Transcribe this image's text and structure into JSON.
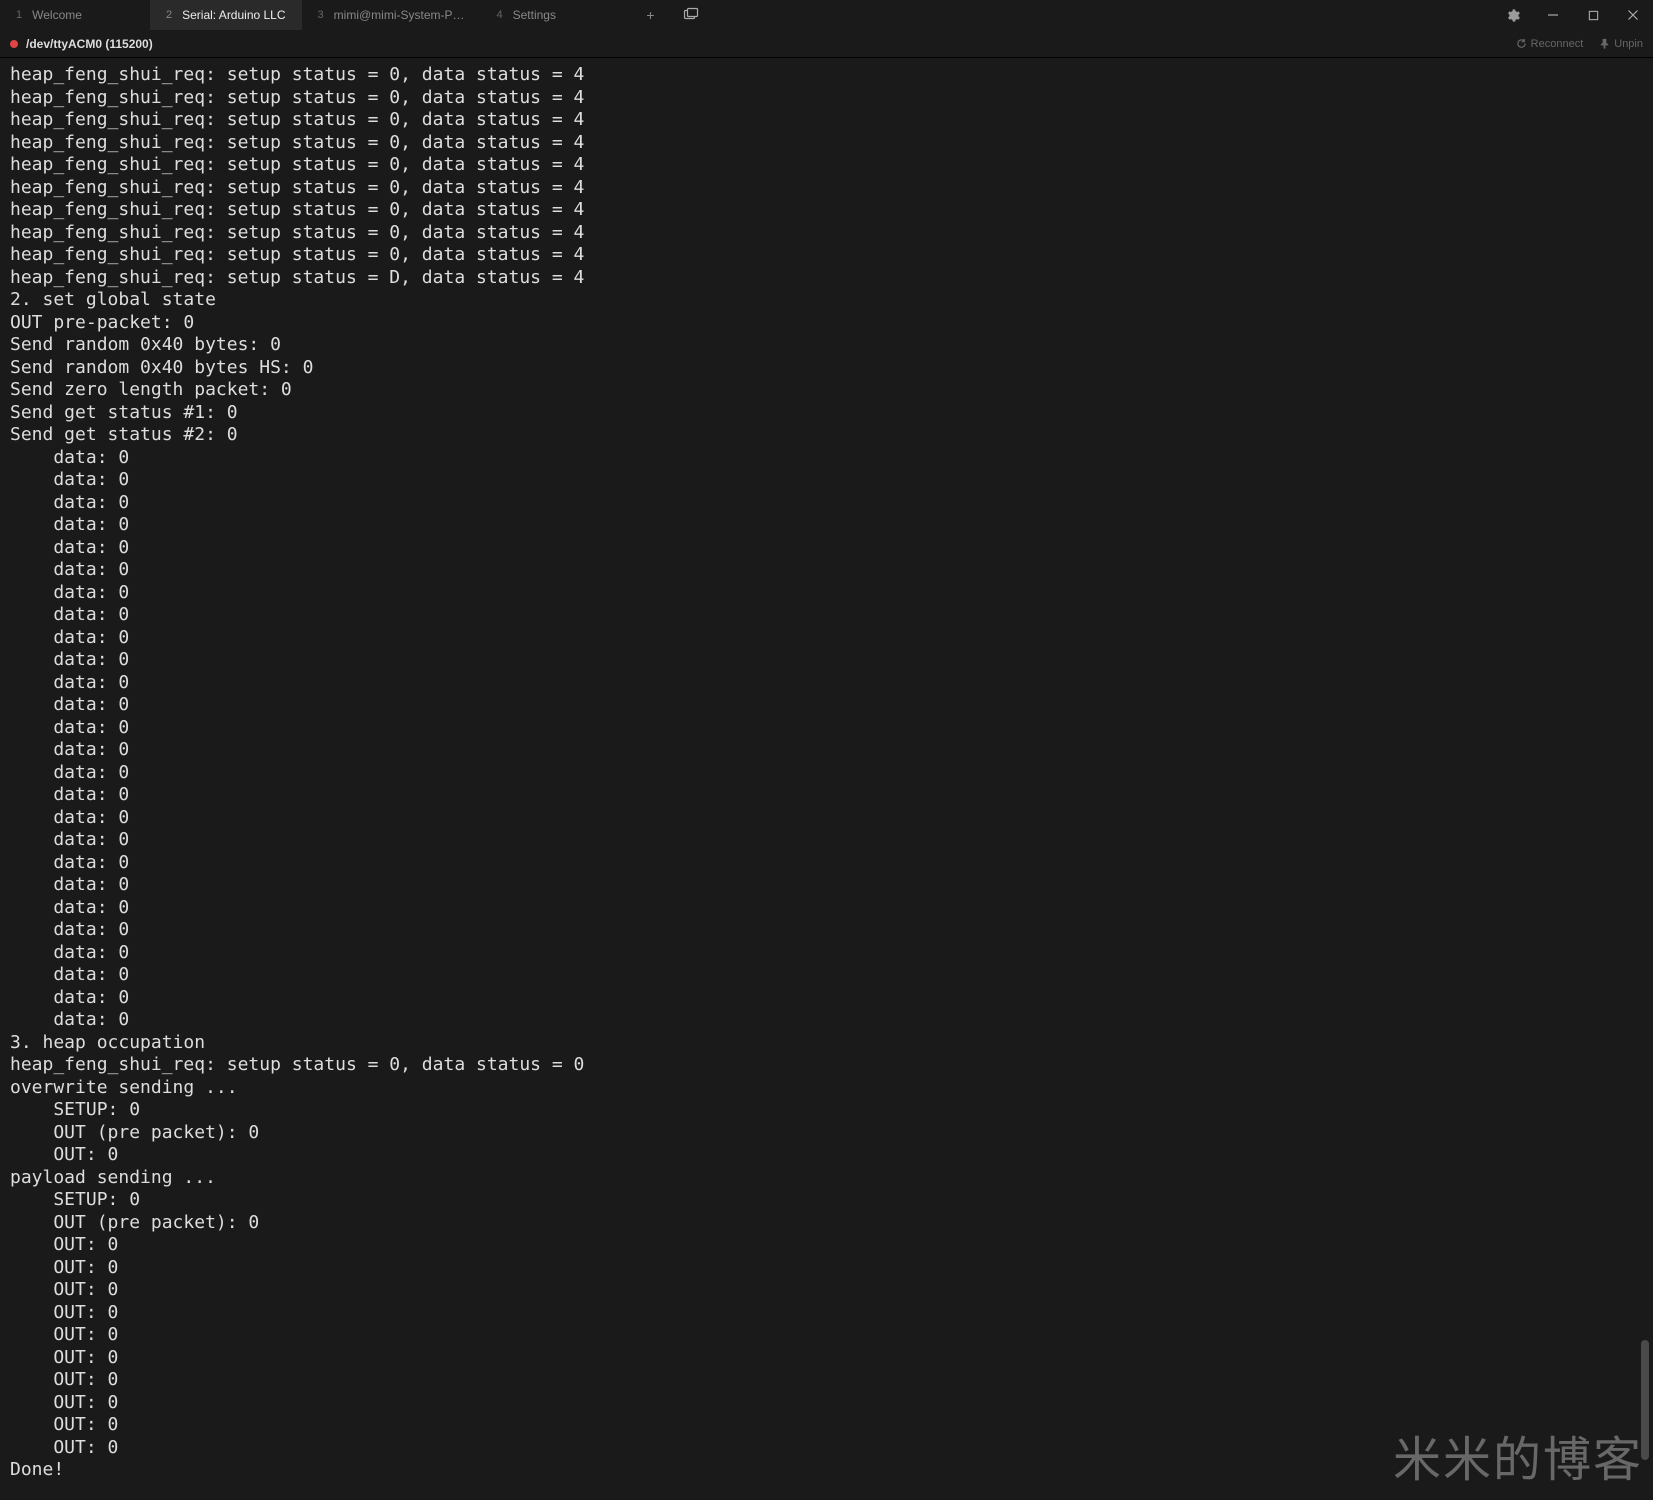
{
  "tabs": [
    {
      "num": "1",
      "title": "Welcome"
    },
    {
      "num": "2",
      "title": "Serial: Arduino LLC"
    },
    {
      "num": "3",
      "title": "mimi@mimi-System-P…"
    },
    {
      "num": "4",
      "title": "Settings"
    }
  ],
  "active_tab_index": 1,
  "subheader": {
    "port": "/dev/ttyACM0 (115200)",
    "reconnect": "Reconnect",
    "unpin": "Unpin"
  },
  "terminal_lines": [
    "heap_feng_shui_req: setup status = 0, data status = 4",
    "heap_feng_shui_req: setup status = 0, data status = 4",
    "heap_feng_shui_req: setup status = 0, data status = 4",
    "heap_feng_shui_req: setup status = 0, data status = 4",
    "heap_feng_shui_req: setup status = 0, data status = 4",
    "heap_feng_shui_req: setup status = 0, data status = 4",
    "heap_feng_shui_req: setup status = 0, data status = 4",
    "heap_feng_shui_req: setup status = 0, data status = 4",
    "heap_feng_shui_req: setup status = 0, data status = 4",
    "heap_feng_shui_req: setup status = D, data status = 4",
    "2. set global state",
    "OUT pre-packet: 0",
    "Send random 0x40 bytes: 0",
    "Send random 0x40 bytes HS: 0",
    "Send zero length packet: 0",
    "Send get status #1: 0",
    "Send get status #2: 0",
    "    data: 0",
    "    data: 0",
    "    data: 0",
    "    data: 0",
    "    data: 0",
    "    data: 0",
    "    data: 0",
    "    data: 0",
    "    data: 0",
    "    data: 0",
    "    data: 0",
    "    data: 0",
    "    data: 0",
    "    data: 0",
    "    data: 0",
    "    data: 0",
    "    data: 0",
    "    data: 0",
    "    data: 0",
    "    data: 0",
    "    data: 0",
    "    data: 0",
    "    data: 0",
    "    data: 0",
    "    data: 0",
    "    data: 0",
    "3. heap occupation",
    "heap_feng_shui_req: setup status = 0, data status = 0",
    "overwrite sending ...",
    "    SETUP: 0",
    "    OUT (pre packet): 0",
    "    OUT: 0",
    "payload sending ...",
    "    SETUP: 0",
    "    OUT (pre packet): 0",
    "    OUT: 0",
    "    OUT: 0",
    "    OUT: 0",
    "    OUT: 0",
    "    OUT: 0",
    "    OUT: 0",
    "    OUT: 0",
    "    OUT: 0",
    "    OUT: 0",
    "    OUT: 0",
    "Done!"
  ],
  "watermark": "米米的博客"
}
